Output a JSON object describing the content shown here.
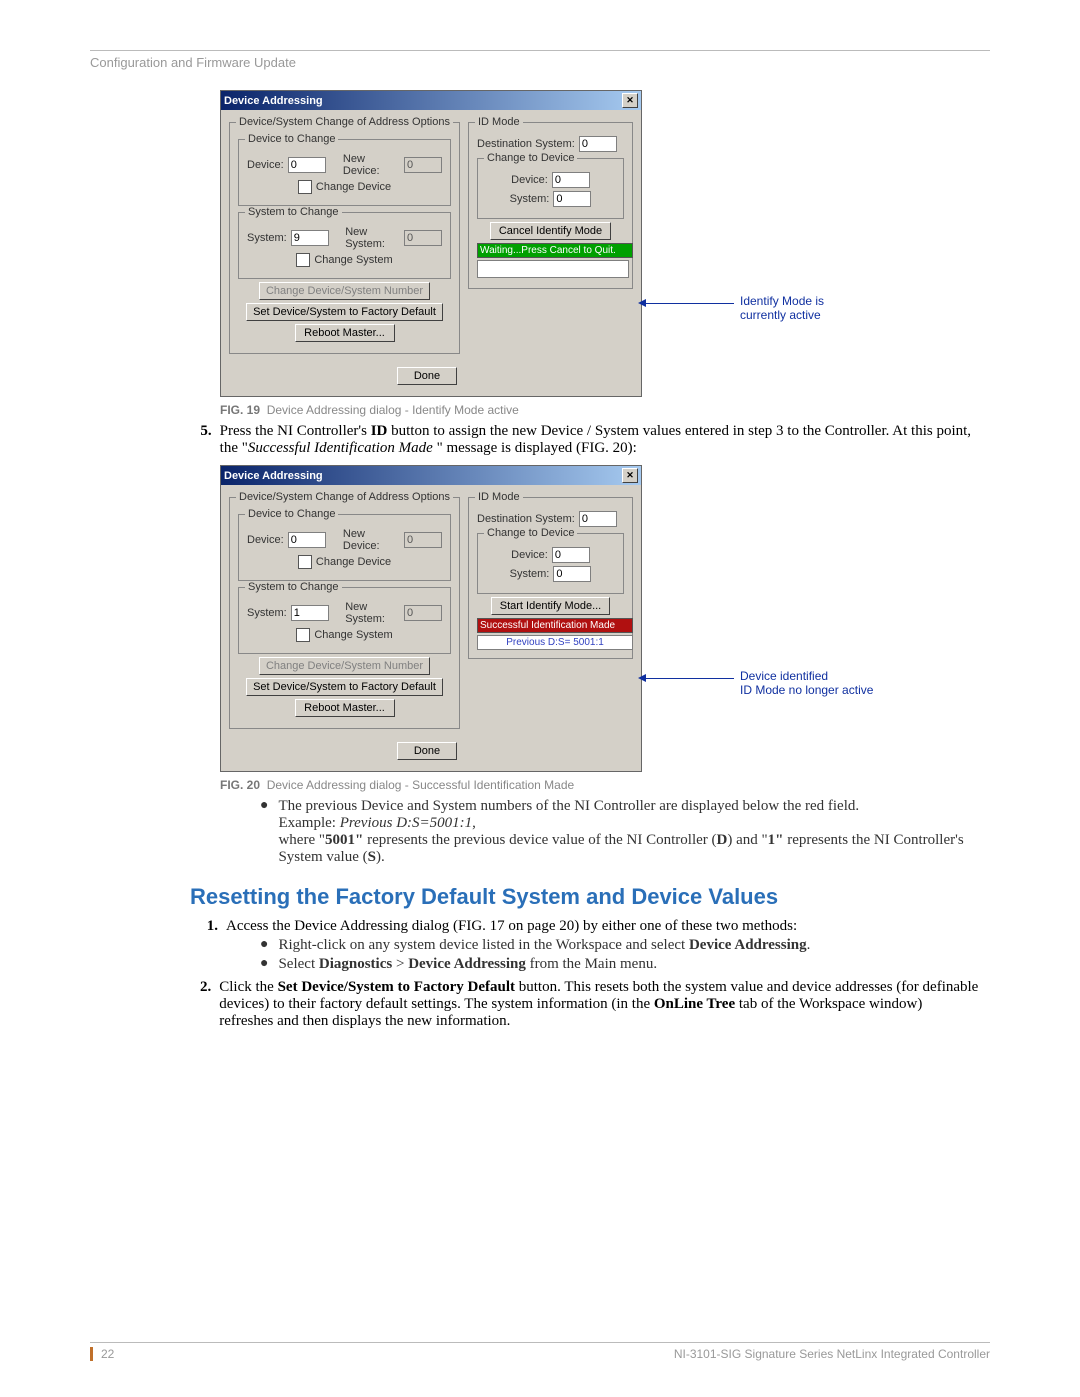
{
  "header": {
    "breadcrumb": "Configuration and Firmware Update"
  },
  "dialog19": {
    "title": "Device Addressing",
    "group_main": "Device/System Change of Address Options",
    "group_dev": "Device to Change",
    "device_lbl": "Device:",
    "device_val": "0",
    "new_device_lbl": "New Device:",
    "new_device_val": "0",
    "change_device_lbl": "Change Device",
    "group_sys": "System to Change",
    "system_lbl": "System:",
    "system_val": "9",
    "new_system_lbl": "New System:",
    "new_system_val": "0",
    "change_system_lbl": "Change System",
    "btn_change": "Change Device/System Number",
    "btn_factory": "Set Device/System to Factory Default",
    "btn_reboot": "Reboot Master...",
    "group_id": "ID Mode",
    "dest_sys_lbl": "Destination System:",
    "dest_sys_val": "0",
    "group_change_to": "Change to Device",
    "c_device_lbl": "Device:",
    "c_device_val": "0",
    "c_system_lbl": "System:",
    "c_system_val": "0",
    "btn_start_id": "Cancel Identify Mode",
    "status": "Waiting...Press Cancel to Quit.",
    "done": "Done",
    "annotation": "Identify Mode is\ncurrently active"
  },
  "fig19": {
    "label": "FIG. 19",
    "caption": "Device Addressing dialog - Identify Mode active"
  },
  "step5": {
    "num": "5.",
    "line1a": "Press the NI Controller's ",
    "line1b": "ID",
    "line1c": " button to assign the new Device / System values entered in step 3 to the Controller. At this point, the \"",
    "line1d": "Successful Identification Made ",
    "line1e": "\" message is displayed (FIG. 20):"
  },
  "dialog20": {
    "title": "Device Addressing",
    "group_main": "Device/System Change of Address Options",
    "group_dev": "Device to Change",
    "device_lbl": "Device:",
    "device_val": "0",
    "new_device_lbl": "New Device:",
    "new_device_val": "0",
    "change_device_lbl": "Change Device",
    "group_sys": "System to Change",
    "system_lbl": "System:",
    "system_val": "1",
    "new_system_lbl": "New System:",
    "new_system_val": "0",
    "change_system_lbl": "Change System",
    "btn_change": "Change Device/System Number",
    "btn_factory": "Set Device/System to Factory Default",
    "btn_reboot": "Reboot Master...",
    "group_id": "ID Mode",
    "dest_sys_lbl": "Destination System:",
    "dest_sys_val": "0",
    "group_change_to": "Change to Device",
    "c_device_lbl": "Device:",
    "c_device_val": "0",
    "c_system_lbl": "System:",
    "c_system_val": "0",
    "btn_start_id": "Start Identify Mode...",
    "status": "Successful Identification Made",
    "previous": "Previous D:S= 5001:1",
    "done": "Done",
    "annotation": "Device identified\nID Mode no longer active"
  },
  "fig20": {
    "label": "FIG. 20",
    "caption": "Device Addressing dialog - Successful Identification Made"
  },
  "bullets1": {
    "b1": "The previous Device and System numbers of the NI Controller are displayed below the red field.",
    "ex_prefix": "Example: ",
    "ex_italic": "Previous D:S=5001:1",
    "ex_comma": ",",
    "b2a": "where \"",
    "b2b": "5001\"",
    "b2c": " represents the previous device value of the NI Controller (",
    "b2d": "D",
    "b2e": ") and \"",
    "b2f": "1\"",
    "b2g": " represents the NI Controller's System value (",
    "b2h": "S",
    "b2i": ")."
  },
  "heading": "Resetting the Factory Default System and Device Values",
  "reset_steps": {
    "s1": {
      "num": "1.",
      "text": "Access the Device Addressing dialog (FIG. 17 on page 20) by either one of these two methods:"
    },
    "s1b1a": "Right-click on any system device listed in the Workspace and select ",
    "s1b1b": "Device Addressing",
    "s1b1c": ".",
    "s1b2a": "Select ",
    "s1b2b": "Diagnostics",
    "s1b2c": " > ",
    "s1b2d": "Device Addressing",
    "s1b2e": " from the Main menu.",
    "s2": {
      "num": "2.",
      "a": "Click the ",
      "b": "Set Device/System to Factory Default",
      "c": " button. This resets both the system value and device addresses (for definable devices) to their factory default settings. The system information (in the ",
      "d": "OnLine Tree",
      "e": " tab of the Workspace window) refreshes and then displays the new information."
    }
  },
  "footer": {
    "page": "22",
    "doc": "NI-3101-SIG Signature Series NetLinx Integrated Controller"
  }
}
